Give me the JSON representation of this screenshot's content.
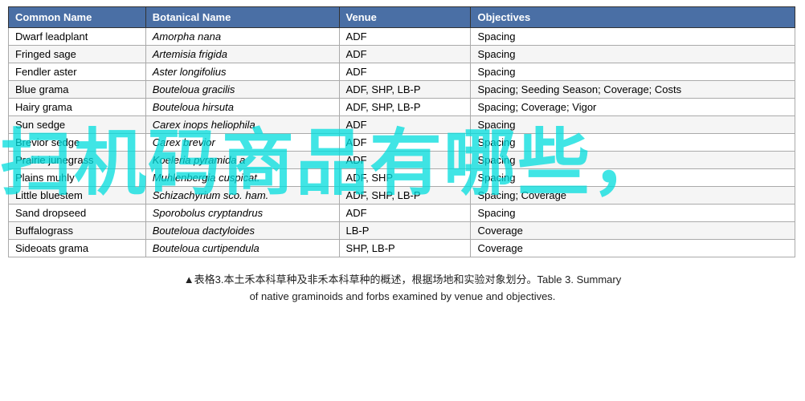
{
  "table": {
    "headers": [
      "Common Name",
      "Botanical  Name",
      "Venue",
      "Objectives"
    ],
    "rows": [
      {
        "common": "Dwarf leadplant",
        "botanical": "Amorpha nana",
        "venue": "ADF",
        "objectives": "Spacing"
      },
      {
        "common": "Fringed sage",
        "botanical": "Artemisia frigida",
        "venue": "ADF",
        "objectives": "Spacing"
      },
      {
        "common": "Fendler aster",
        "botanical": "Aster longifolius",
        "venue": "ADF",
        "objectives": "Spacing"
      },
      {
        "common": "Blue grama",
        "botanical": "Bouteloua gracilis",
        "venue": "ADF, SHP, LB-P",
        "objectives": "Spacing; Seeding Season;  Coverage; Costs"
      },
      {
        "common": "Hairy grama",
        "botanical": "Bouteloua hirsuta",
        "venue": "ADF, SHP, LB-P",
        "objectives": "Spacing; Coverage; Vigor"
      },
      {
        "common": "Sun sedge",
        "botanical": "Carex inops heliophila",
        "venue": "ADF",
        "objectives": "Spacing"
      },
      {
        "common": "Brevior sedge",
        "botanical": "Carex brevior",
        "venue": "ADF",
        "objectives": "Spacing"
      },
      {
        "common": "Prairie junegrass",
        "botanical": "Koeleria pyramida a",
        "venue": "ADF",
        "objectives": "Spacing"
      },
      {
        "common": "Plains muhly",
        "botanical": "Muhlenbergia cuspicat.",
        "venue": "ADF, SHP",
        "objectives": "Spacing"
      },
      {
        "common": "Little bluestem",
        "botanical": "Schizachyrium sco. ham.",
        "venue": "ADF, SHP, LB-P",
        "objectives": "Spacing; Coverage"
      },
      {
        "common": "Sand dropseed",
        "botanical": "Sporobolus cryptandrus",
        "venue": "ADF",
        "objectives": "Spacing"
      },
      {
        "common": "Buffalograss",
        "botanical": "Bouteloua dactyloides",
        "venue": "LB-P",
        "objectives": "Coverage"
      },
      {
        "common": "Sideoats grama",
        "botanical": "Bouteloua curtipendula",
        "venue": "SHP, LB-P",
        "objectives": "Coverage"
      }
    ]
  },
  "caption": {
    "line1": "▲表格3.本土禾本科草种及非禾本科草种的概述，根据场地和实验对象划分。Table 3. Summary",
    "line2": "of native graminoids and forbs examined by venue and objectives."
  },
  "watermark": {
    "text": "扫机码商品有哪些，"
  }
}
